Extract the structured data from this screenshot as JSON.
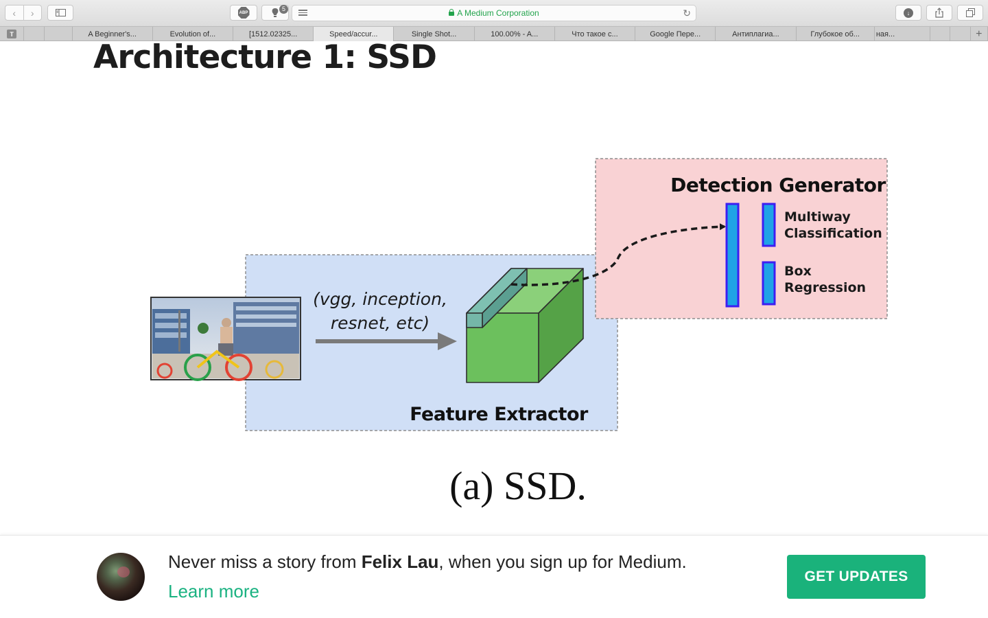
{
  "browser": {
    "url_text": "A Medium Corporation",
    "abp_label": "ABP",
    "extension_badge": "5",
    "tabs": [
      {
        "label": "T",
        "pinned": true
      },
      {
        "label": ""
      },
      {
        "label": ""
      },
      {
        "label": "A Beginner's..."
      },
      {
        "label": "Evolution of..."
      },
      {
        "label": "[1512.02325..."
      },
      {
        "label": "Speed/accur...",
        "active": true
      },
      {
        "label": "Single Shot..."
      },
      {
        "label": "100.00% - A..."
      },
      {
        "label": "Что такое с..."
      },
      {
        "label": "Google Пере..."
      },
      {
        "label": "Антиплагиа..."
      },
      {
        "label": "Глубокое об..."
      },
      {
        "label": "ная..."
      },
      {
        "label": ""
      },
      {
        "label": ""
      }
    ],
    "new_tab_label": "+",
    "icons": [
      "back-icon",
      "forward-icon",
      "sidebar-icon",
      "adblock-icon",
      "extension-icon",
      "reader-icon",
      "lock-icon",
      "reload-icon",
      "download-icon",
      "share-icon",
      "tabs-overview-icon"
    ]
  },
  "article": {
    "heading": "Architecture 1: SSD"
  },
  "diagram": {
    "input_image_description_name": "photo-thumbnail",
    "arrow_label_line1": "(vgg, inception,",
    "arrow_label_line2": "resnet, etc)",
    "feature_extractor_label": "Feature Extractor",
    "detection_generator_label": "Detection Generator",
    "multiway_line1": "Multiway",
    "multiway_line2": "Classification",
    "box_line1": "Box",
    "box_line2": "Regression",
    "caption": "(a) SSD.",
    "colors": {
      "extractor_bg": "#d0dff6",
      "generator_bg": "#f9d2d4",
      "cube_green": "#6fc160",
      "cube_teal": "#75b7a8",
      "bar_blue": "#1fa3e6",
      "bar_border": "#3d1ef2"
    }
  },
  "banner": {
    "message_prefix": "Never miss a story from ",
    "author": "Felix Lau",
    "message_suffix": ", when you sign up for Medium.",
    "learn_more": "Learn more",
    "cta": "GET UPDATES",
    "cta_color": "#1ab27b"
  }
}
